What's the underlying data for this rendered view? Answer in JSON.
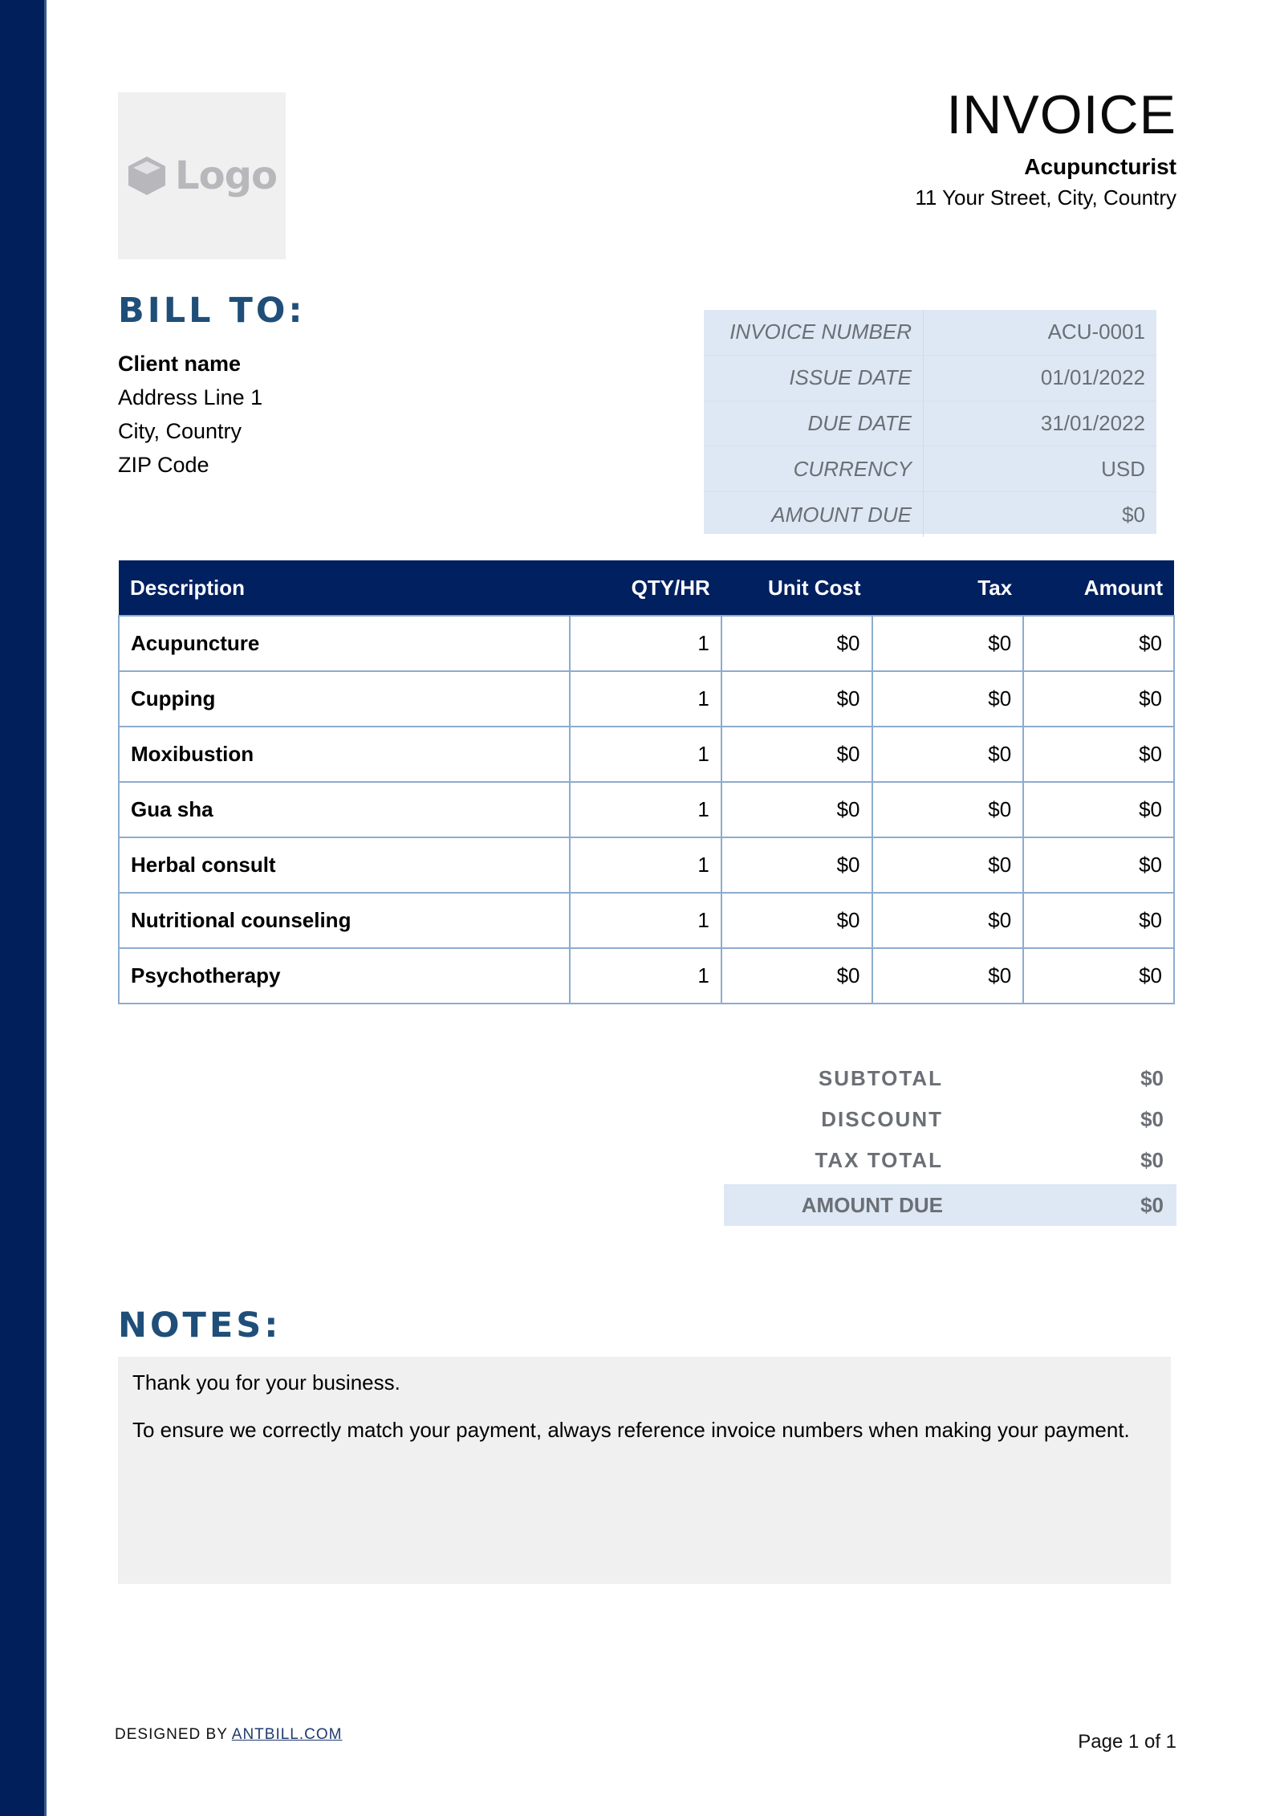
{
  "header": {
    "logo_text": "Logo",
    "title": "INVOICE",
    "business_name": "Acupuncturist",
    "business_address": "11 Your Street, City, Country"
  },
  "bill_to": {
    "heading": "BILL TO:",
    "lines": [
      "Client name",
      "Address Line 1",
      "City, Country",
      "ZIP Code"
    ]
  },
  "invoice_info": [
    {
      "label": "INVOICE NUMBER",
      "value": "ACU-0001"
    },
    {
      "label": "ISSUE DATE",
      "value": "01/01/2022"
    },
    {
      "label": "DUE DATE",
      "value": "31/01/2022"
    },
    {
      "label": "CURRENCY",
      "value": "USD"
    },
    {
      "label": "AMOUNT DUE",
      "value": "$0"
    }
  ],
  "items_table": {
    "columns": [
      "Description",
      "QTY/HR",
      "Unit Cost",
      "Tax",
      "Amount"
    ],
    "rows": [
      [
        "Acupuncture",
        "1",
        "$0",
        "$0",
        "$0"
      ],
      [
        "Cupping",
        "1",
        "$0",
        "$0",
        "$0"
      ],
      [
        "Moxibustion",
        "1",
        "$0",
        "$0",
        "$0"
      ],
      [
        "Gua sha",
        "1",
        "$0",
        "$0",
        "$0"
      ],
      [
        "Herbal consult",
        "1",
        "$0",
        "$0",
        "$0"
      ],
      [
        "Nutritional counseling",
        "1",
        "$0",
        "$0",
        "$0"
      ],
      [
        "Psychotherapy",
        "1",
        "$0",
        "$0",
        "$0"
      ]
    ]
  },
  "totals": [
    {
      "label": "SUBTOTAL",
      "value": "$0"
    },
    {
      "label": "DISCOUNT",
      "value": "$0"
    },
    {
      "label": "TAX TOTAL",
      "value": "$0"
    },
    {
      "label": "AMOUNT DUE",
      "value": "$0"
    }
  ],
  "notes": {
    "heading": "NOTES:",
    "paragraphs": [
      "Thank you for your business.",
      "To ensure we correctly match your payment, always reference invoice numbers when making your payment."
    ]
  },
  "footer": {
    "designed_by": "DESIGNED BY ",
    "link_text": "ANTBILL.COM",
    "page": "Page 1 of 1"
  },
  "colors": {
    "sidebar": "#001f5b",
    "table_header": "#012060",
    "heading": "#1f4e79",
    "info_bg": "#dde8f4",
    "notes_bg": "#f0f0f0"
  }
}
